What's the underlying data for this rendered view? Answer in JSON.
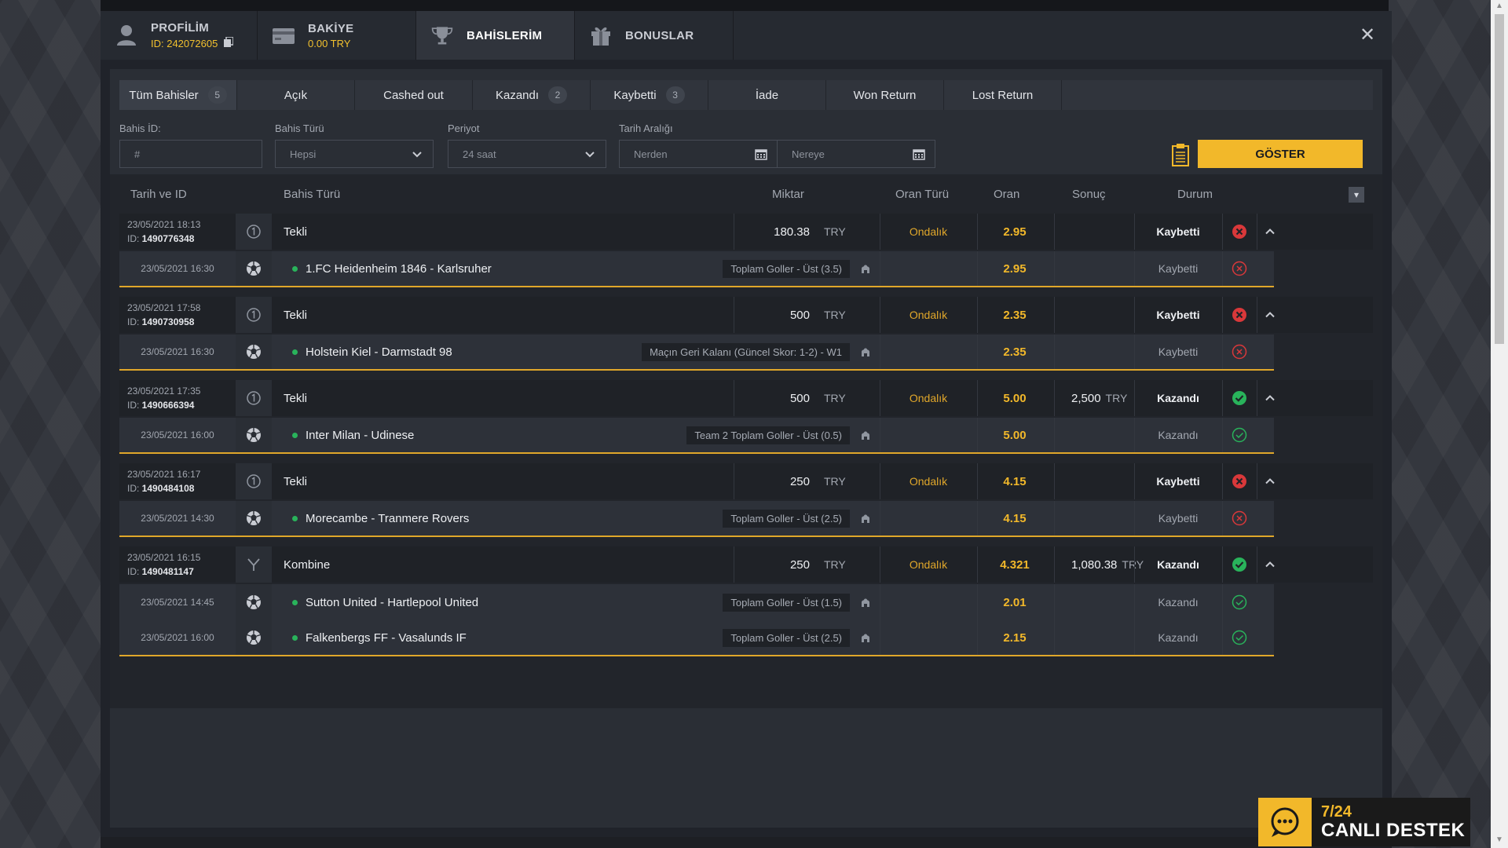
{
  "header": {
    "tabs": [
      {
        "title": "PROFİLİM",
        "sub": "ID: 242072605",
        "icon": "user-icon"
      },
      {
        "title": "BAKİYE",
        "sub": "0.00 TRY",
        "icon": "wallet-icon"
      },
      {
        "title": "BAHİSLERİM",
        "sub": "",
        "icon": "trophy-icon"
      },
      {
        "title": "BONUSLAR",
        "sub": "",
        "icon": "gift-icon"
      }
    ],
    "close": "✕"
  },
  "filters": {
    "tabs": [
      {
        "label": "Tüm Bahisler",
        "count": "5"
      },
      {
        "label": "Açık",
        "count": ""
      },
      {
        "label": "Cashed out",
        "count": ""
      },
      {
        "label": "Kazandı",
        "count": "2"
      },
      {
        "label": "Kaybetti",
        "count": "3"
      },
      {
        "label": "İade",
        "count": ""
      },
      {
        "label": "Won Return",
        "count": ""
      },
      {
        "label": "Lost Return",
        "count": ""
      }
    ],
    "bet_id_label": "Bahis İD:",
    "bet_id_placeholder": "#",
    "bet_type_label": "Bahis Türü",
    "bet_type_value": "Hepsi",
    "period_label": "Periyot",
    "period_value": "24 saat",
    "date_range_label": "Tarih Aralığı",
    "date_from_placeholder": "Nerden",
    "date_to_placeholder": "Nereye",
    "show_button": "GÖSTER"
  },
  "table": {
    "headers": {
      "date_id": "Tarih ve ID",
      "bet_type": "Bahis Türü",
      "amount": "Miktar",
      "odds_type": "Oran Türü",
      "odds": "Oran",
      "result": "Sonuç",
      "status": "Durum"
    },
    "bets": [
      {
        "date": "23/05/2021 18:13",
        "id": "1490776348",
        "type": "Tekli",
        "kind": "single",
        "amount": "180.38",
        "currency": "TRY",
        "odds_type": "Ondalık",
        "odds": "2.95",
        "result": "",
        "result_cur": "",
        "status": "Kaybetti",
        "won": false,
        "legs": [
          {
            "date": "23/05/2021 16:30",
            "match": "1.FC Heidenheim 1846 - Karlsruher",
            "market": "Toplam Goller - Üst (3.5)",
            "odds": "2.95",
            "status": "Kaybetti",
            "won": false
          }
        ]
      },
      {
        "date": "23/05/2021 17:58",
        "id": "1490730958",
        "type": "Tekli",
        "kind": "single",
        "amount": "500",
        "currency": "TRY",
        "odds_type": "Ondalık",
        "odds": "2.35",
        "result": "",
        "result_cur": "",
        "status": "Kaybetti",
        "won": false,
        "legs": [
          {
            "date": "23/05/2021 16:30",
            "match": "Holstein Kiel - Darmstadt 98",
            "market": "Maçın Geri Kalanı (Güncel Skor: 1-2) - W1",
            "odds": "2.35",
            "status": "Kaybetti",
            "won": false
          }
        ]
      },
      {
        "date": "23/05/2021 17:35",
        "id": "1490666394",
        "type": "Tekli",
        "kind": "single",
        "amount": "500",
        "currency": "TRY",
        "odds_type": "Ondalık",
        "odds": "5.00",
        "result": "2,500",
        "result_cur": "TRY",
        "status": "Kazandı",
        "won": true,
        "legs": [
          {
            "date": "23/05/2021 16:00",
            "match": "Inter Milan - Udinese",
            "market": "Team 2 Toplam Goller - Üst (0.5)",
            "odds": "5.00",
            "status": "Kazandı",
            "won": true
          }
        ]
      },
      {
        "date": "23/05/2021 16:17",
        "id": "1490484108",
        "type": "Tekli",
        "kind": "single",
        "amount": "250",
        "currency": "TRY",
        "odds_type": "Ondalık",
        "odds": "4.15",
        "result": "",
        "result_cur": "",
        "status": "Kaybetti",
        "won": false,
        "legs": [
          {
            "date": "23/05/2021 14:30",
            "match": "Morecambe - Tranmere Rovers",
            "market": "Toplam Goller - Üst (2.5)",
            "odds": "4.15",
            "status": "Kaybetti",
            "won": false
          }
        ]
      },
      {
        "date": "23/05/2021 16:15",
        "id": "1490481147",
        "type": "Kombine",
        "kind": "combo",
        "amount": "250",
        "currency": "TRY",
        "odds_type": "Ondalık",
        "odds": "4.321",
        "result": "1,080.38",
        "result_cur": "TRY",
        "status": "Kazandı",
        "won": true,
        "legs": [
          {
            "date": "23/05/2021 14:45",
            "match": "Sutton United - Hartlepool United",
            "market": "Toplam Goller - Üst (1.5)",
            "odds": "2.01",
            "status": "Kazandı",
            "won": true
          },
          {
            "date": "23/05/2021 16:00",
            "match": "Falkenbergs FF - Vasalunds IF",
            "market": "Toplam Goller - Üst (2.5)",
            "odds": "2.15",
            "status": "Kazandı",
            "won": true
          }
        ]
      }
    ]
  },
  "support": {
    "line1": "7/24",
    "line2": "CANLI DESTEK"
  },
  "colors": {
    "accent": "#f2b82a",
    "won": "#29b35b",
    "lost": "#d9383a"
  }
}
